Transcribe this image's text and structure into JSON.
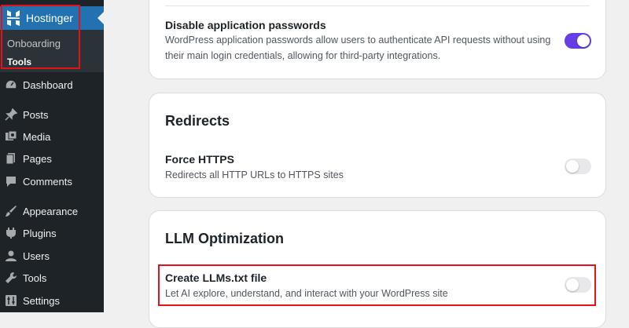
{
  "sidebar": {
    "brand": {
      "label": "Hostinger",
      "icon": "hostinger-logo-icon"
    },
    "submenu": [
      {
        "label": "Onboarding",
        "current": false
      },
      {
        "label": "Tools",
        "current": true
      }
    ],
    "items": [
      {
        "label": "Dashboard",
        "icon": "dashboard-icon"
      },
      {
        "label": "Posts",
        "icon": "pin-icon"
      },
      {
        "label": "Media",
        "icon": "media-icon"
      },
      {
        "label": "Pages",
        "icon": "pages-icon"
      },
      {
        "label": "Comments",
        "icon": "comment-icon"
      },
      {
        "label": "Appearance",
        "icon": "brush-icon"
      },
      {
        "label": "Plugins",
        "icon": "plugin-icon"
      },
      {
        "label": "Users",
        "icon": "user-icon"
      },
      {
        "label": "Tools",
        "icon": "wrench-icon"
      },
      {
        "label": "Settings",
        "icon": "settings-icon"
      }
    ]
  },
  "security_card": {
    "setting": {
      "title": "Disable application passwords",
      "description": "WordPress application passwords allow users to authenticate API requests without using their main login credentials, allowing for third-party integrations.",
      "enabled": true
    }
  },
  "redirects_card": {
    "title": "Redirects",
    "setting": {
      "title": "Force HTTPS",
      "description": "Redirects all HTTP URLs to HTTPS sites",
      "enabled": false
    }
  },
  "llm_card": {
    "title": "LLM Optimization",
    "setting": {
      "title": "Create LLMs.txt file",
      "description": "Let AI explore, understand, and interact with your WordPress site",
      "enabled": false
    }
  },
  "colors": {
    "sidebar_bg": "#1d2327",
    "active_blue": "#2271b1",
    "toggle_on": "#673de6",
    "highlight_red": "#e2121b"
  }
}
